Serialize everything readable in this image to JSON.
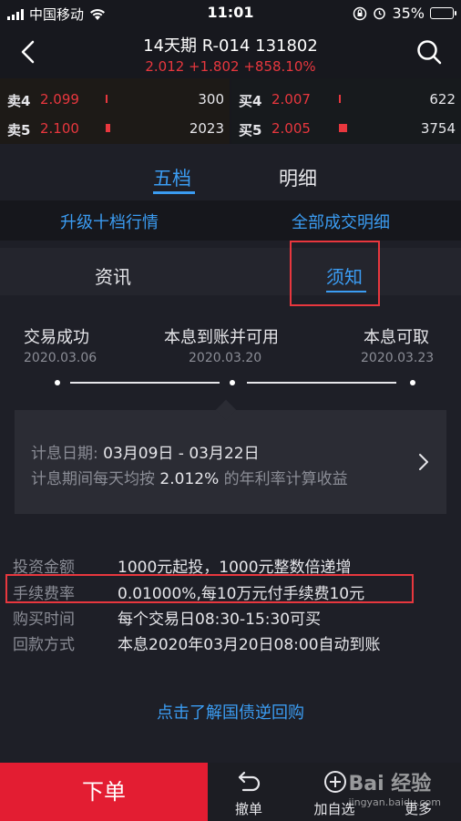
{
  "status_bar": {
    "carrier": "中国移动",
    "time": "11:01",
    "battery": "35%"
  },
  "header": {
    "title": "14天期 R-014 131802",
    "quote": "2.012 +1.802 +858.10%"
  },
  "order_book": {
    "sell": [
      {
        "label": "卖4",
        "price": "2.099",
        "volume": "300"
      },
      {
        "label": "卖5",
        "price": "2.100",
        "volume": "2023"
      }
    ],
    "buy": [
      {
        "label": "买4",
        "price": "2.007",
        "volume": "622"
      },
      {
        "label": "买5",
        "price": "2.005",
        "volume": "3754"
      }
    ]
  },
  "tabs": [
    {
      "label": "五档",
      "active": true
    },
    {
      "label": "明细",
      "active": false
    }
  ],
  "links": {
    "upgrade": "升级十档行情",
    "all_trades": "全部成交明细"
  },
  "sub_tabs": [
    {
      "label": "资讯",
      "active": false
    },
    {
      "label": "须知",
      "active": true
    }
  ],
  "timeline": [
    {
      "label": "交易成功",
      "date": "2020.03.06"
    },
    {
      "label": "本息到账并可用",
      "date": "2020.03.20"
    },
    {
      "label": "本息可取",
      "date": "2020.03.23"
    }
  ],
  "interest_card": {
    "line1_prefix": "计息日期: ",
    "line1_value": "03月09日 - 03月22日",
    "line2_prefix": "计息期间每天均按 ",
    "line2_rate": "2.012%",
    "line2_suffix": " 的年利率计算收益"
  },
  "info": [
    {
      "key": "投资金额",
      "value": "1000元起投，1000元整数倍递增"
    },
    {
      "key": "手续费率",
      "value": "0.01000%,每10万元付手续费10元"
    },
    {
      "key": "购买时间",
      "value": "每个交易日08:30-15:30可买"
    },
    {
      "key": "回款方式",
      "value": "本息2020年03月20日08:00自动到账"
    }
  ],
  "learn_more": "点击了解国债逆回购",
  "bottom_bar": {
    "order": "下单",
    "cancel": "撤单",
    "add_watch": "加自选",
    "more": "更多"
  },
  "watermark": {
    "brand": "Bai 经验",
    "url": "jingyan.baidu.com"
  },
  "colors": {
    "accent": "#3b9cf2",
    "up": "#e8373e",
    "order_button": "#e31d32"
  }
}
